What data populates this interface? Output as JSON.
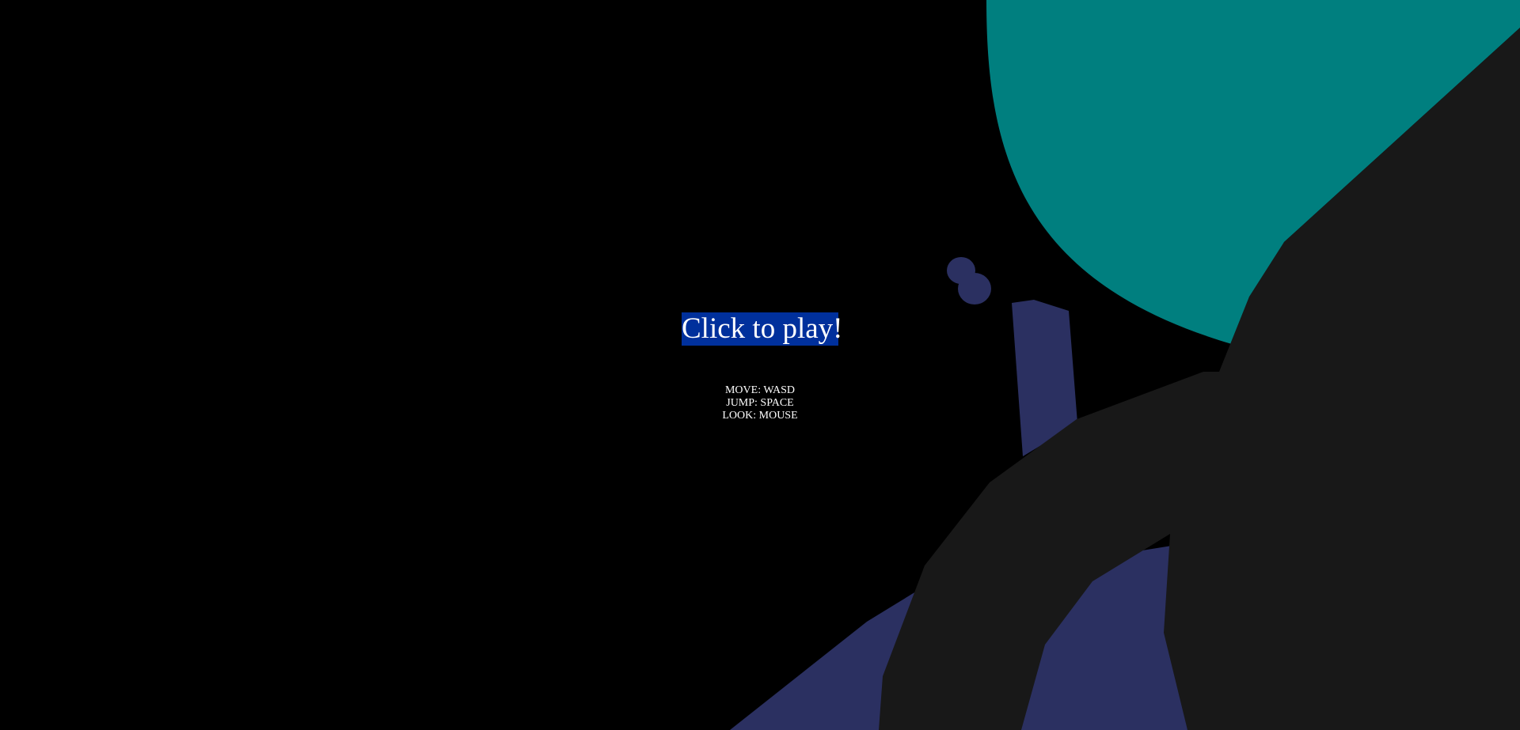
{
  "overlay": {
    "play_label": "Click to play!",
    "controls": {
      "move": "MOVE: WASD",
      "jump": "JUMP: SPACE",
      "look": "LOOK: MOUSE"
    }
  },
  "scene": {
    "background_color": "#000000",
    "sky_shape_color": "#007f7f",
    "terrain_color": "#181818",
    "structure_color": "#2b3061",
    "button_color": "#00309c"
  }
}
